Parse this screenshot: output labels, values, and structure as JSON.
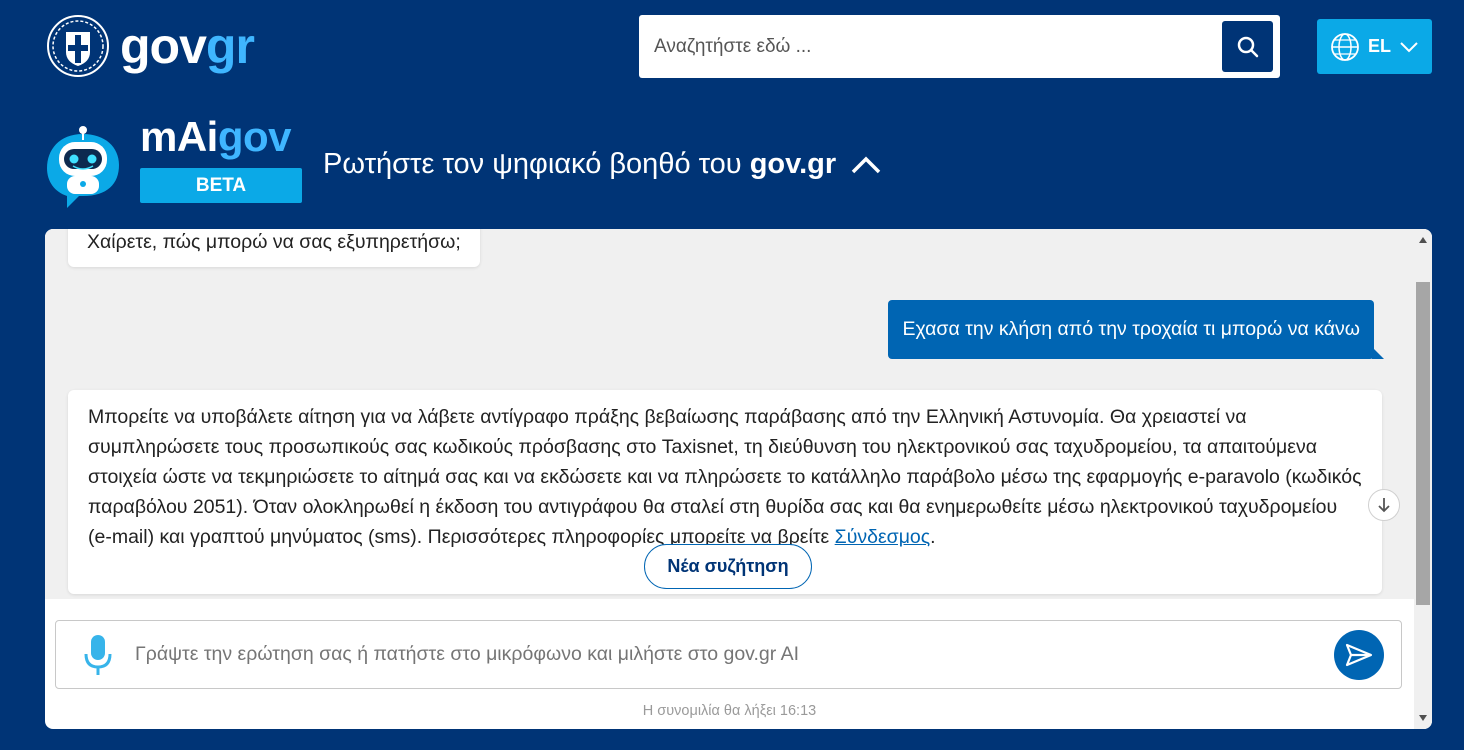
{
  "header": {
    "logo_text_main": "gov",
    "logo_text_accent": "gr",
    "search_placeholder": "Αναζητήστε εδώ ...",
    "language": "EL"
  },
  "assistant": {
    "brand_main": "mAi",
    "brand_accent": "gov",
    "badge": "BETA",
    "tagline_prefix": "Ρωτήστε τον ψηφιακό βοηθό του ",
    "tagline_brand": "gov.gr"
  },
  "chat": {
    "greeting": "Χαίρετε, πώς μπορώ να σας εξυπηρετήσω;",
    "user_message": "Εχασα την κλήση από την τροχαία τι μπορώ να κάνω",
    "answer_text": "Μπορείτε να υποβάλετε αίτηση για να λάβετε αντίγραφο πράξης βεβαίωσης παράβασης από την Ελληνική Αστυνομία. Θα χρειαστεί να συμπληρώσετε τους προσωπικούς σας κωδικούς πρόσβασης στο Taxisnet, τη διεύθυνση του ηλεκτρονικού σας ταχυδρομείου, τα απαιτούμενα στοιχεία ώστε να τεκμηριώσετε το αίτημά σας και να εκδώσετε και να πληρώσετε το κατάλληλο παράβολο μέσω της εφαρμογής e-paravolo (κωδικός παραβόλου 2051). Όταν ολοκληρωθεί η έκδοση του αντιγράφου θα σταλεί στη θυρίδα σας και θα ενημερωθείτε μέσω ηλεκτρονικού ταχυδρομείου (e-mail) και γραπτού μηνύματος (sms). Περισσότερες πληροφορίες μπορείτε να βρείτε ",
    "answer_link": "Σύνδεσμος",
    "answer_end": ".",
    "new_chat_label": "Νέα συζήτηση",
    "input_placeholder": "Γράψτε την ερώτηση σας ή πατήστε στο μικρόφωνο και μιλήστε στο gov.gr AI",
    "expiry_note": "Η συνομιλία θα λήξει 16:13"
  },
  "colors": {
    "background": "#003476",
    "accent": "#0ba9e7",
    "primary": "#0065b3"
  }
}
